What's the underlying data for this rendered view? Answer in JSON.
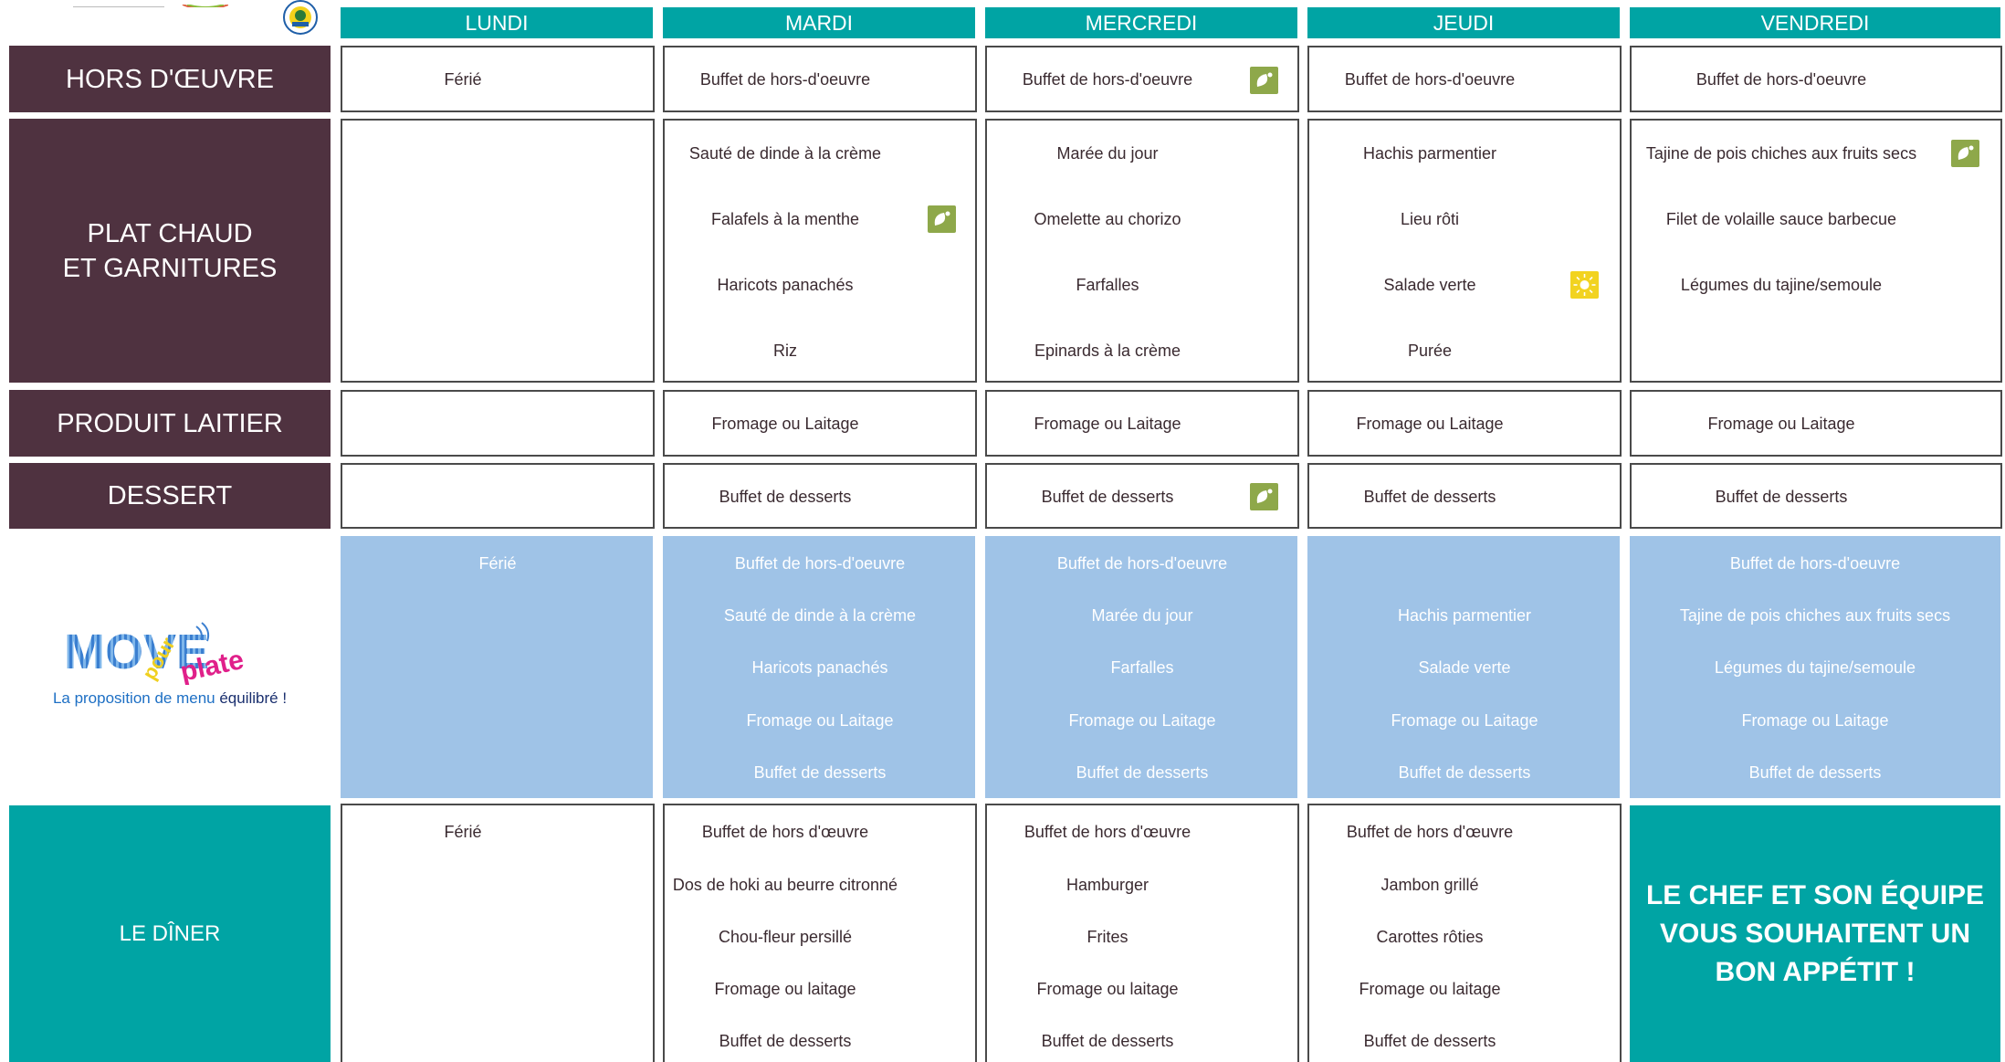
{
  "days": [
    "LUNDI",
    "MARDI",
    "MERCREDI",
    "JEUDI",
    "VENDREDI"
  ],
  "categories": {
    "hors_doeuvre": "HORS D'ŒUVRE",
    "plat_chaud_line1": "PLAT CHAUD",
    "plat_chaud_line2": "ET GARNITURES",
    "produit_laitier": "PRODUIT LAITIER",
    "dessert": "DESSERT",
    "diner": "LE DÎNER"
  },
  "lunch": {
    "hors_doeuvre": [
      "Férié",
      "Buffet de hors-d'oeuvre",
      "Buffet de hors-d'oeuvre",
      "Buffet de hors-d'oeuvre",
      "Buffet de hors-d'oeuvre"
    ],
    "plat_chaud": {
      "mardi": [
        "Sauté de dinde à la crème",
        "Falafels à la menthe",
        "Haricots panachés",
        "Riz"
      ],
      "mercredi": [
        "Marée du jour",
        "Omelette au chorizo",
        "Farfalles",
        "Epinards à la crème"
      ],
      "jeudi": [
        "Hachis parmentier",
        "Lieu rôti",
        "Salade verte",
        "Purée"
      ],
      "vendredi": [
        "Tajine de pois chiches aux fruits secs",
        "Filet de volaille sauce barbecue",
        "Légumes du tajine/semoule"
      ]
    },
    "produit_laitier": [
      "",
      "Fromage ou Laitage",
      "Fromage ou Laitage",
      "Fromage ou Laitage",
      "Fromage ou Laitage"
    ],
    "dessert": [
      "",
      "Buffet de desserts",
      "Buffet de desserts",
      "Buffet de desserts",
      "Buffet de desserts"
    ]
  },
  "move_pour_plate": {
    "logo_text": "MOVE",
    "logo_pour": "pour",
    "logo_plate": "plate",
    "tagline_part1": "La proposition de menu ",
    "tagline_part2": "équilibré !",
    "lundi": [
      "Férié"
    ],
    "mardi": [
      "Buffet de hors-d'oeuvre",
      "Sauté de dinde à la crème",
      "Haricots panachés",
      "Fromage ou Laitage",
      "Buffet de desserts"
    ],
    "mercredi": [
      "Buffet de hors-d'oeuvre",
      "Marée du jour",
      "Farfalles",
      "Fromage ou Laitage",
      "Buffet de desserts"
    ],
    "jeudi": [
      "",
      "Hachis parmentier",
      "Salade verte",
      "Fromage ou Laitage",
      "Buffet de desserts"
    ],
    "vendredi": [
      "Buffet de hors-d'oeuvre",
      "Tajine de pois chiches aux fruits secs",
      "Légumes du tajine/semoule",
      "Fromage ou Laitage",
      "Buffet de desserts"
    ]
  },
  "diner": {
    "lundi": [
      "Férié"
    ],
    "mardi": [
      "Buffet de hors d'œuvre",
      "Dos de hoki au beurre citronné",
      "Chou-fleur persillé",
      "Fromage ou laitage",
      "Buffet de desserts"
    ],
    "mercredi": [
      "Buffet de hors d'œuvre",
      "Hamburger",
      "Frites",
      "Fromage ou laitage",
      "Buffet de desserts"
    ],
    "jeudi": [
      "Buffet de hors d'œuvre",
      "Jambon grillé",
      "Carottes rôties",
      "Fromage ou laitage",
      "Buffet de desserts"
    ]
  },
  "chef_message": [
    "LE CHEF ET SON ÉQUIPE",
    "VOUS SOUHAITENT UN",
    "BON APPÉTIT !"
  ],
  "icons": {
    "vegetarian": "leaf-icon",
    "seasonal": "sun-icon"
  },
  "colors": {
    "teal": "#00a4a4",
    "plum": "#4f3240",
    "light_blue": "#9fc3e7",
    "leaf_green": "#8ea84a",
    "sun_yellow": "#f2d320"
  }
}
